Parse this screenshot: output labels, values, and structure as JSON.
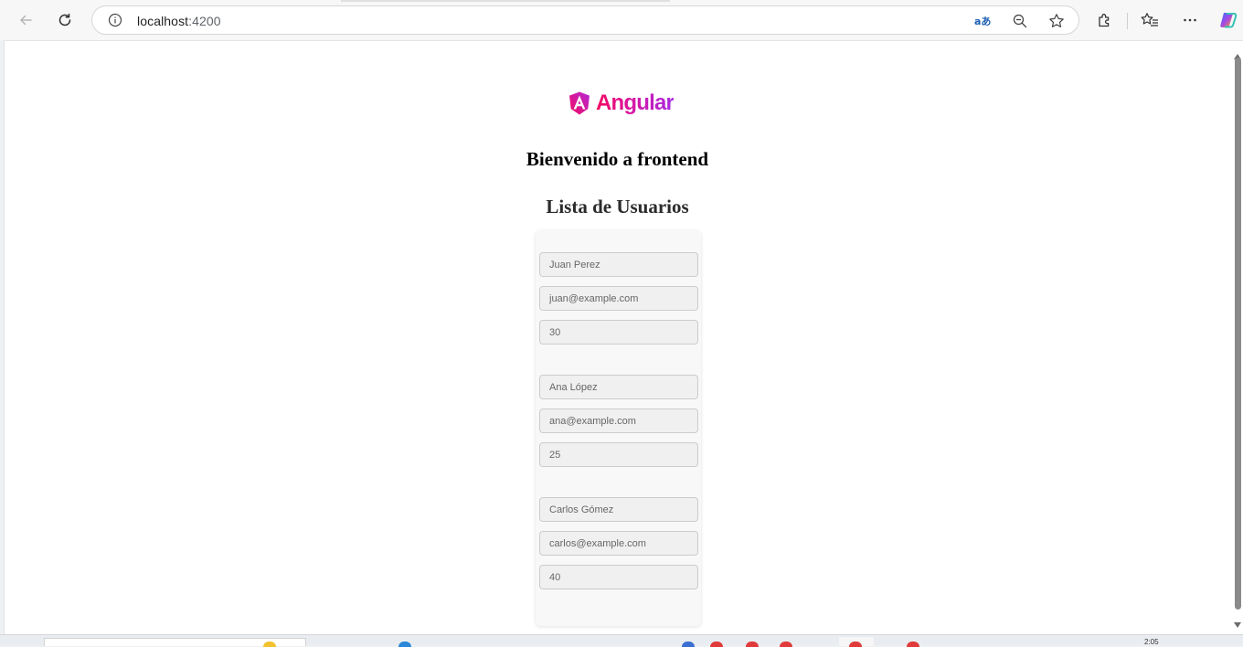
{
  "browser": {
    "url_host": "localhost",
    "url_port": ":4200",
    "icons": [
      "back-icon",
      "refresh-icon",
      "info-icon",
      "read-aloud-icon",
      "zoom-out-icon",
      "favorite-star-icon",
      "extensions-icon",
      "favorites-icon",
      "more-icon",
      "copilot-icon"
    ]
  },
  "page": {
    "logo_text": "Angular",
    "welcome_heading": "Bienvenido a frontend",
    "list_heading": "Lista de Usuarios"
  },
  "users": [
    {
      "name": "Juan Perez",
      "email": "juan@example.com",
      "age": "30"
    },
    {
      "name": "Ana López",
      "email": "ana@example.com",
      "age": "25"
    },
    {
      "name": "Carlos Gómez",
      "email": "carlos@example.com",
      "age": "40"
    }
  ],
  "taskbar": {
    "clock": "2:05"
  },
  "colors": {
    "angular_gradient_start": "#f4085f",
    "angular_gradient_end": "#a928e0"
  }
}
